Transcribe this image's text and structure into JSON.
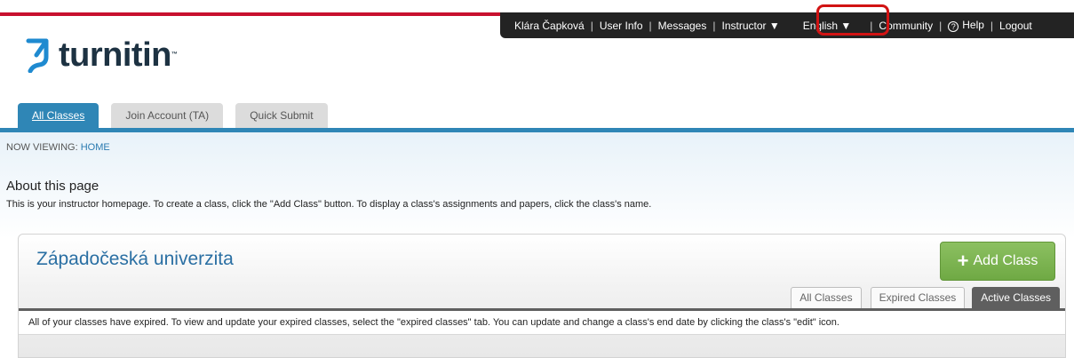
{
  "topnav": {
    "user": "Klára Čapková",
    "user_info": "User Info",
    "messages": "Messages",
    "instructor": "Instructor ▼",
    "language": "English ▼",
    "community": "Community",
    "help": "Help",
    "logout": "Logout",
    "separator": "|"
  },
  "logo": {
    "text": "turnitin",
    "tm": "™"
  },
  "tabs": [
    {
      "label": "All Classes"
    },
    {
      "label": "Join Account (TA)"
    },
    {
      "label": "Quick Submit"
    }
  ],
  "breadcrumb": {
    "prefix": "NOW VIEWING: ",
    "link": "HOME"
  },
  "about": {
    "title": "About this page",
    "text": "This is your instructor homepage. To create a class, click the \"Add Class\" button. To display a class's assignments and papers, click the class's name."
  },
  "panel": {
    "title": "Západočeská univerzita",
    "add_button": "Add Class",
    "class_tabs": [
      "All Classes",
      "Expired Classes",
      "Active Classes"
    ],
    "message": "All of your classes have expired. To view and update your expired classes, select the \"expired classes\" tab. You can update and change a class's end date by clicking the class's \"edit\" icon."
  },
  "colors": {
    "brand_red": "#c8102e",
    "tab_blue": "#2f86b6",
    "add_green": "#6fa944",
    "highlight": "#d11313"
  }
}
